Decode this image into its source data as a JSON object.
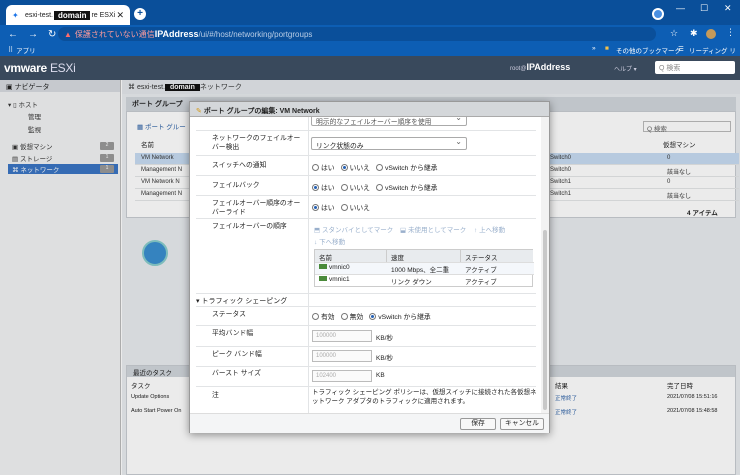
{
  "browser": {
    "tab_title_prefix": "esxi-test.",
    "tab_title_mask": "domain",
    "tab_title_suffix": "re ESXi",
    "url_warning": "保護されていない通信",
    "url_host": "IPAddress",
    "url_path": "/ui/#/host/networking/portgroups",
    "bookmark_apps": "アプリ",
    "bookmark_other": "その他のブックマーク",
    "reading_list": "リーディング リスト"
  },
  "esxi": {
    "logo_vm": "vm",
    "logo_ware": "ware",
    "logo_product": "ESXi",
    "host_prefix": "root@",
    "host_ip": "IPAddress",
    "help": "ヘルプ ▾",
    "search_placeholder": "Q 検索"
  },
  "navigator": {
    "title": "ナビゲータ",
    "items": [
      {
        "label": "ホスト"
      },
      {
        "label": "管理"
      },
      {
        "label": "監視"
      },
      {
        "label": "仮想マシン",
        "badge": "2"
      },
      {
        "label": "ストレージ",
        "badge": "1"
      },
      {
        "label": "ネットワーク",
        "badge": "1"
      }
    ]
  },
  "main": {
    "crumb_prefix": "esxi-test.",
    "crumb_mask": "domain",
    "crumb_suffix": "ネットワーク",
    "tab_label": "ポート グループ",
    "add_portgroup": "ポート グルー",
    "col_name": "名前",
    "col_vm": "仮想マシン",
    "search": "Q 検索",
    "rows": [
      {
        "name": "VM Network",
        "vswitch": "vSwitch0",
        "vms": "0"
      },
      {
        "name": "Management N",
        "vswitch": "vSwitch0",
        "vms": "該当なし"
      },
      {
        "name": "VM Network N",
        "vswitch": "vSwitch1",
        "vms": "0"
      },
      {
        "name": "Management N",
        "vswitch": "vSwitch1",
        "vms": "該当なし"
      }
    ],
    "item_count": "4 アイテム",
    "recent_tasks": "最近のタスク",
    "task_col": "タスク",
    "result_col": "結果",
    "done_col": "完了日時",
    "tasks": [
      {
        "name": "Update Options",
        "result": "正常終了",
        "done": "2021/07/08 15:51:16"
      },
      {
        "name": "Auto Start Power On",
        "result": "正常終了",
        "done": "2021/07/08 15:48:58"
      }
    ]
  },
  "modal": {
    "title": "ポート グループの編集: VM Network",
    "top_select": "明示的なフェイルオーバー順序を使用",
    "failover_detect_label": "ネットワークのフェイルオーバー検出",
    "failover_detect_value": "リンク状態のみ",
    "notify_label": "スイッチへの通知",
    "failback_label": "フェイルバック",
    "override_label": "フェイルオーバー順序のオーバーライド",
    "order_label": "フェイルオーバーの順序",
    "yes": "はい",
    "no": "いいえ",
    "inherit": "vSwitch から継承",
    "enabled": "有効",
    "disabled": "無効",
    "act_standby": "スタンバイとしてマーク",
    "act_unused": "未使用としてマーク",
    "act_up": "上へ移動",
    "act_down": "下へ移動",
    "nic_cols": {
      "name": "名前",
      "speed": "速度",
      "status": "ステータス"
    },
    "nics": [
      {
        "name": "vmnic0",
        "speed": "1000 Mbps、全二重",
        "status": "アクティブ"
      },
      {
        "name": "vmnic1",
        "speed": "リンク ダウン",
        "status": "アクティブ"
      }
    ],
    "shaping_section": "▾ トラフィック シェーピング",
    "status_label": "ステータス",
    "avg_bw_label": "平均バンド幅",
    "avg_bw_value": "100000",
    "peak_bw_label": "ピーク バンド幅",
    "peak_bw_value": "100000",
    "burst_label": "バースト サイズ",
    "burst_value": "102400",
    "unit_kbps": "KB/秒",
    "unit_kb": "KB",
    "note_label": "注",
    "note_text": "トラフィック シェーピング ポリシーは、仮想スイッチに接続された各仮想ネットワーク アダプタのトラフィックに適用されます。",
    "save": "保存",
    "cancel": "キャンセル"
  }
}
